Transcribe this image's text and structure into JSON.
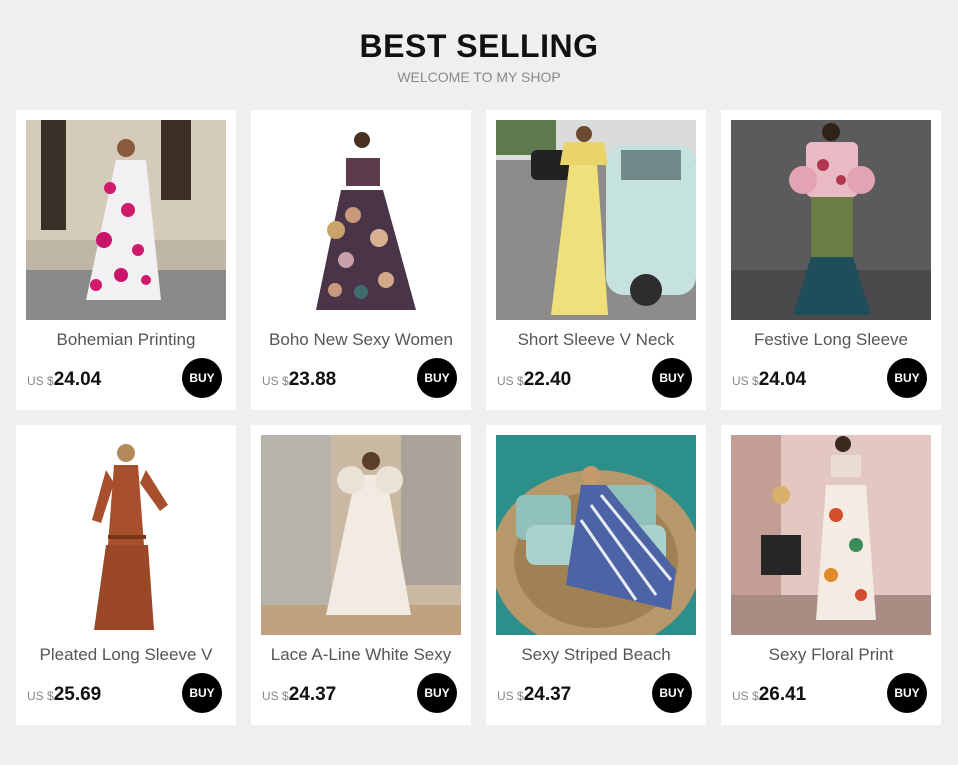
{
  "header": {
    "title": "BEST SELLING",
    "subtitle": "WELCOME TO MY SHOP"
  },
  "products": [
    {
      "name": "Bohemian Printing",
      "currency": "US $",
      "price": "24.04",
      "buy_label": "BUY",
      "image": "model-pink-floral-maxi-dress-photo"
    },
    {
      "name": "Boho New Sexy Women",
      "currency": "US $",
      "price": "23.88",
      "buy_label": "BUY",
      "image": "model-dark-floral-two-piece-tiered-dress-photo"
    },
    {
      "name": "Short Sleeve V Neck",
      "currency": "US $",
      "price": "22.40",
      "buy_label": "BUY",
      "image": "model-yellow-ruffle-jumpsuit-street-car-photo"
    },
    {
      "name": "Festive Long Sleeve",
      "currency": "US $",
      "price": "24.04",
      "buy_label": "BUY",
      "image": "model-pink-green-patchwork-dress-photo"
    },
    {
      "name": "Pleated Long Sleeve V",
      "currency": "US $",
      "price": "25.69",
      "buy_label": "BUY",
      "image": "model-rust-brown-deep-v-maxi-dress-photo"
    },
    {
      "name": "Lace A-Line White Sexy",
      "currency": "US $",
      "price": "24.37",
      "buy_label": "BUY",
      "image": "model-white-lace-gown-photo"
    },
    {
      "name": "Sexy Striped  Beach",
      "currency": "US $",
      "price": "24.37",
      "buy_label": "BUY",
      "image": "model-blue-striped-dress-rattan-daybed-photo"
    },
    {
      "name": "Sexy Floral Print",
      "currency": "US $",
      "price": "26.41",
      "buy_label": "BUY",
      "image": "models-floral-crop-top-skirt-set-photo"
    }
  ]
}
